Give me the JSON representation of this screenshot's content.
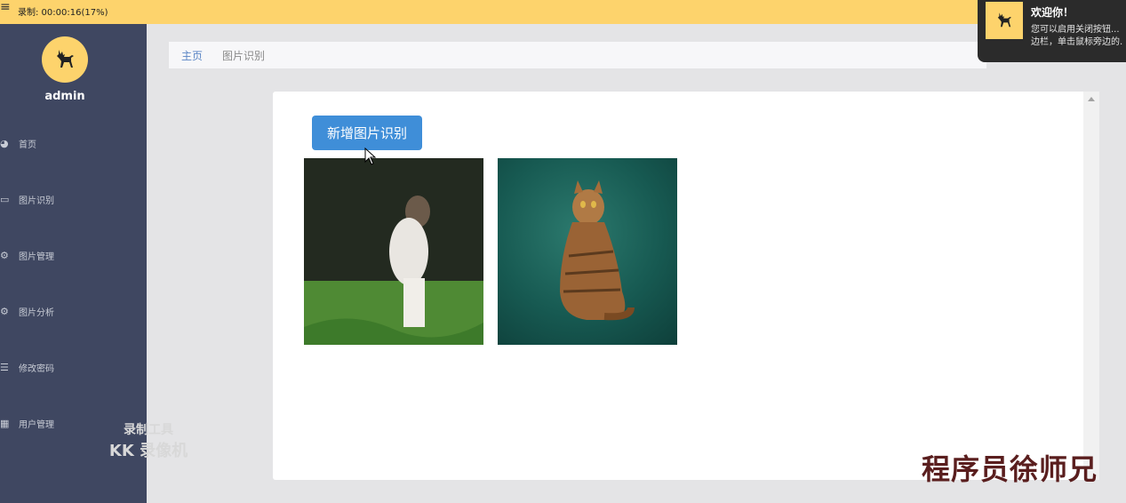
{
  "topbar": {
    "recording_status": "录制: 00:00:16(17%)"
  },
  "sidebar": {
    "username": "admin",
    "items": [
      {
        "label": "首页",
        "icon": "dashboard-icon"
      },
      {
        "label": "图片识别",
        "icon": "monitor-icon"
      },
      {
        "label": "图片管理",
        "icon": "gears-icon"
      },
      {
        "label": "图片分析",
        "icon": "gears-icon"
      },
      {
        "label": "修改密码",
        "icon": "list-icon"
      },
      {
        "label": "用户管理",
        "icon": "grid-icon"
      }
    ]
  },
  "recorder_watermark": {
    "line1": "录制工具",
    "line2": "KK 录像机"
  },
  "breadcrumb": {
    "home": "主页",
    "current": "图片识别"
  },
  "main": {
    "add_button_label": "新增图片识别",
    "images": [
      {
        "alt": "dog on grass"
      },
      {
        "alt": "tabby cat on green background"
      }
    ]
  },
  "toast": {
    "title": "欢迎你！",
    "body_line1": "您可以启用关闭按钮...",
    "body_line2": "边栏，单击鼠标旁边的..."
  },
  "author_watermark": "程序员徐师兄",
  "colors": {
    "topbar": "#fdd36c",
    "sidebar": "#3f4761",
    "accent_button": "#3f8ed8",
    "watermark": "#5a1e1e"
  }
}
